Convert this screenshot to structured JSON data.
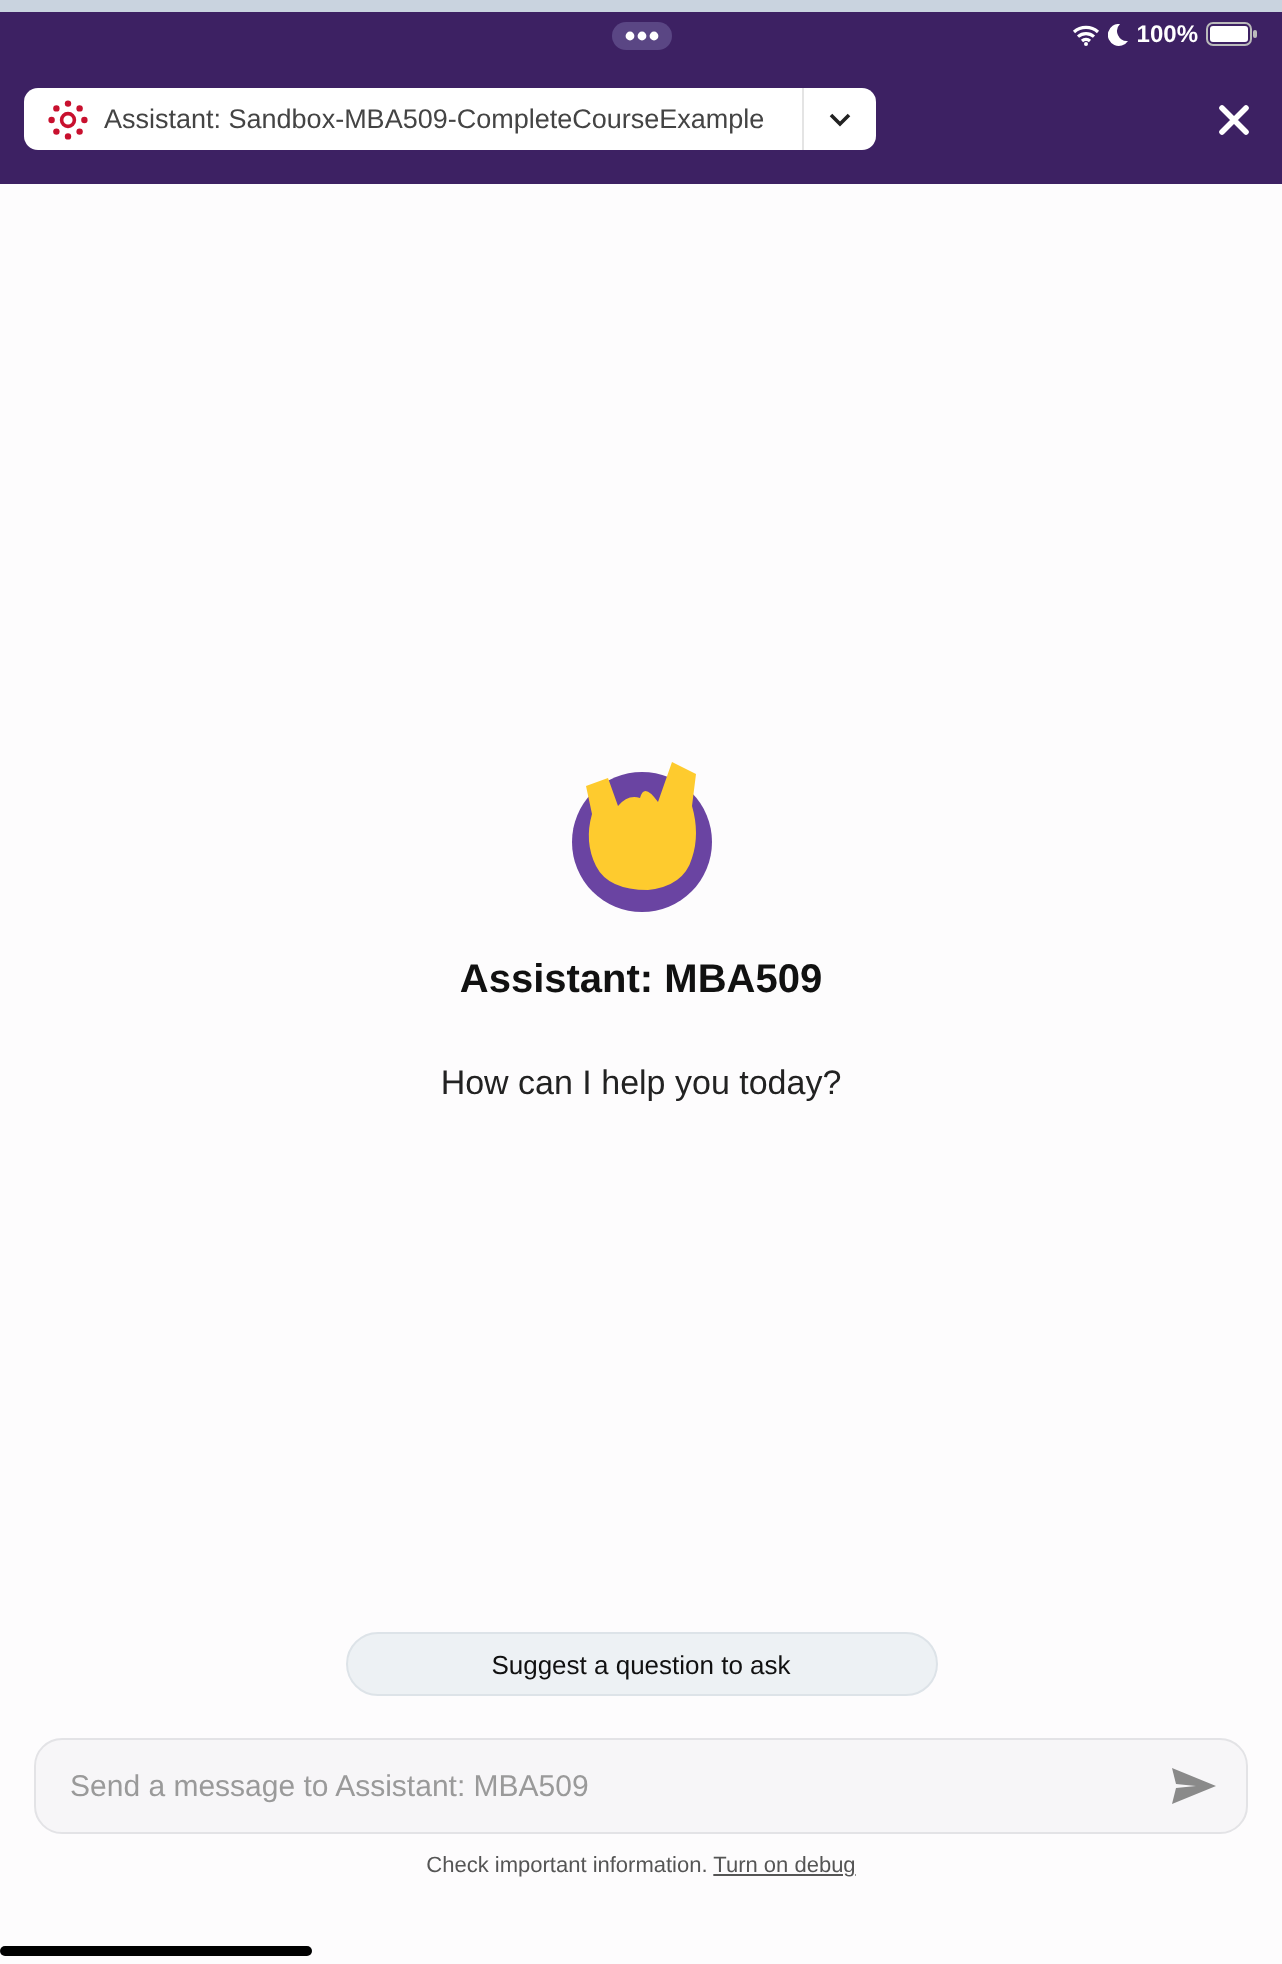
{
  "status_bar": {
    "battery": "100%"
  },
  "header": {
    "selector": "Assistant: Sandbox-MBA509-CompleteCourseExample"
  },
  "welcome": {
    "title": "Assistant: MBA509",
    "subtitle": "How can I help you today?"
  },
  "suggest_button": "Suggest a question to ask",
  "composer": {
    "placeholder": "Send a message to Assistant: MBA509"
  },
  "footer": {
    "note": "Check important information.",
    "link": "Turn on debug"
  }
}
